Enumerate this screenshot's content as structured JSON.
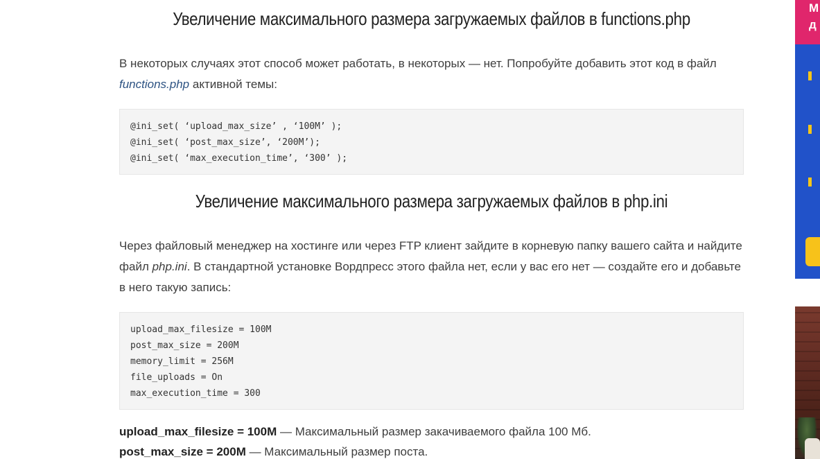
{
  "article": {
    "heading_functions": "Увеличение максимального размера загружаемых файлов в functions.php",
    "para_functions": {
      "text_before": "В некоторых случаях этот способ может работать, в некоторых — нет. Попробуйте добавить этот код в файл ",
      "filename": "functions.php",
      "text_after": " активной темы:"
    },
    "code_functions": [
      "@ini_set( ‘upload_max_size’ , ‘100M’ );",
      "@ini_set( ‘post_max_size’, ‘200M’);",
      "@ini_set( ‘max_execution_time’, ‘300’ );"
    ],
    "heading_phpini": "Увеличение максимального размера загружаемых файлов в php.ini",
    "para_phpini": {
      "text_before": "Через файловый менеджер на хостинге или через FTP клиент зайдите в корневую папку вашего сайта и найдите файл ",
      "filename": "php.ini",
      "text_after": ". В стандартной установке Вордпресс этого файла нет, если у вас его нет — создайте его и добавьте в него такую запись:"
    },
    "code_phpini": [
      "upload_max_filesize = 100M",
      "post_max_size = 200M",
      "memory_limit = 256M",
      "file_uploads = On",
      "max_execution_time = 300"
    ],
    "notes": [
      {
        "term": "upload_max_filesize = 100M",
        "desc": " — Максимальный размер закачиваемого файла 100 Мб."
      },
      {
        "term": "post_max_size = 200M",
        "desc": " — Максимальный размер поста."
      }
    ]
  },
  "sidebar": {
    "promo_heading": "М\nд",
    "colors": {
      "promo_bg": "#2152c9",
      "promo_head_bg": "#e0266c",
      "accent": "#f5c518"
    }
  }
}
